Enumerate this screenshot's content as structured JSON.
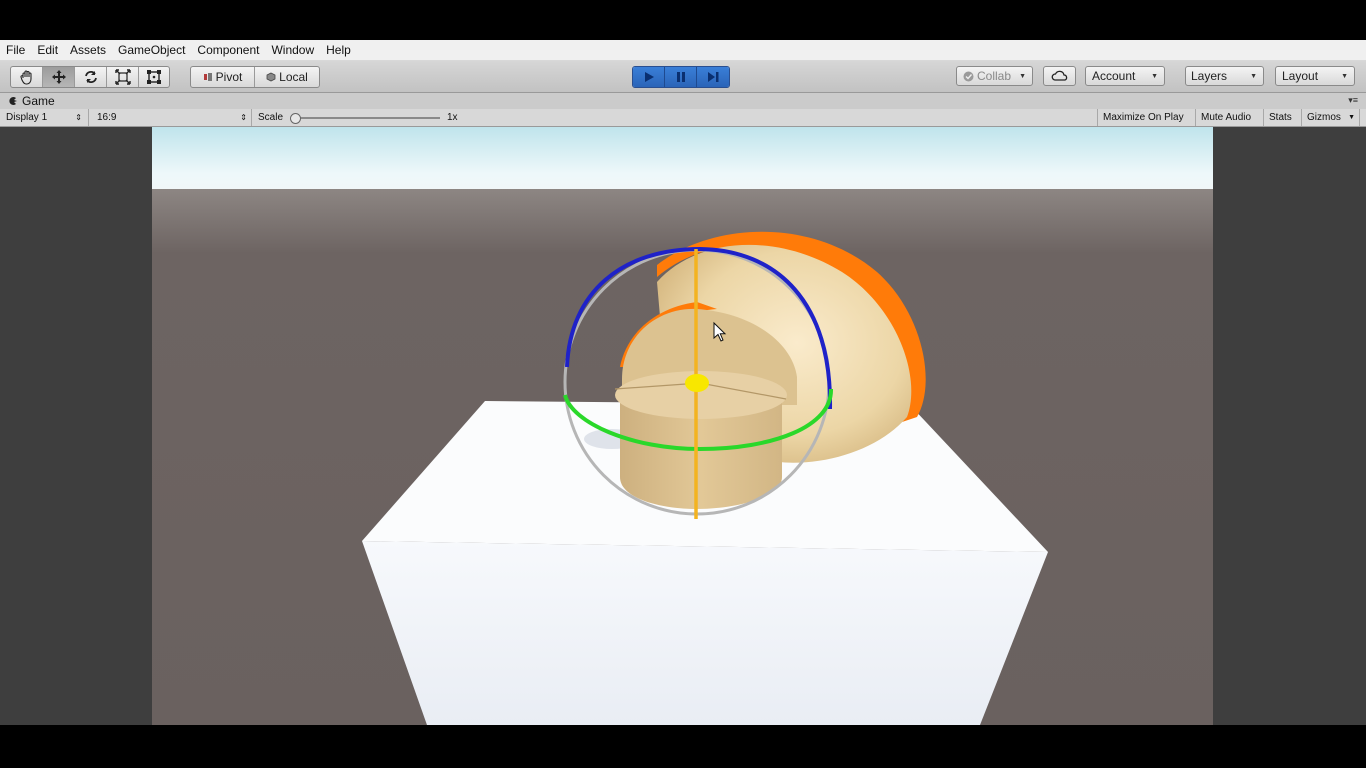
{
  "menu": [
    "File",
    "Edit",
    "Assets",
    "GameObject",
    "Component",
    "Window",
    "Help"
  ],
  "toolbar": {
    "tools": [
      "hand-tool-icon",
      "move-tool-icon",
      "rotate-tool-icon",
      "scale-tool-icon",
      "rect-tool-icon"
    ],
    "pivot_label": "Pivot",
    "local_label": "Local",
    "playback": [
      "play-icon",
      "pause-icon",
      "step-icon"
    ],
    "collab_label": "Collab",
    "account_label": "Account",
    "layers_label": "Layers",
    "layout_label": "Layout"
  },
  "game_tab": {
    "title": "Game",
    "display": "Display 1",
    "aspect": "16:9",
    "scale_label": "Scale",
    "scale_value": "1x",
    "maximize_on_play": "Maximize On Play",
    "mute_audio": "Mute Audio",
    "stats": "Stats",
    "gizmos": "Gizmos"
  },
  "colors": {
    "sky": "#e6f4f8",
    "ground": "#6b6260",
    "box": "#f2f4f8",
    "object": "#e3c898",
    "x_ring": "#2a2acf",
    "y_ring": "#27d827",
    "z_axis": "#f3b320",
    "highlight": "#ff7b09",
    "center": "#f8e700"
  }
}
